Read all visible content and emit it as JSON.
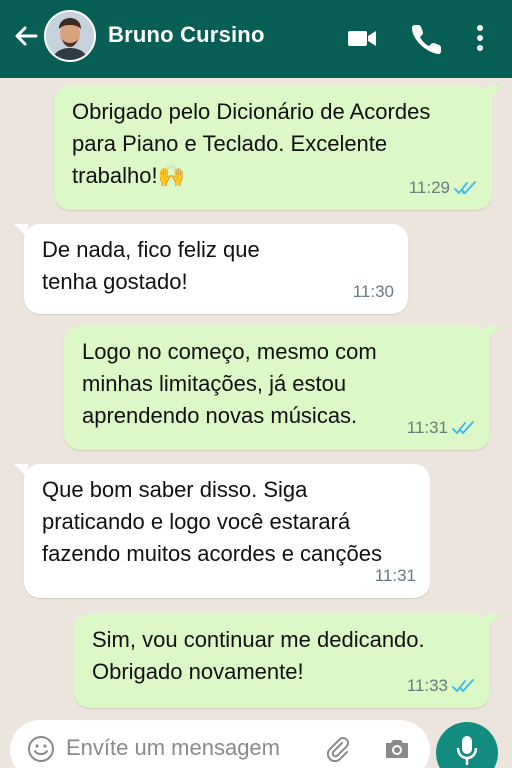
{
  "header": {
    "contact_name": "Bruno Cursino",
    "icons": [
      "back-arrow-icon",
      "avatar",
      "video-call-icon",
      "phone-call-icon",
      "more-options-icon"
    ]
  },
  "messages": [
    {
      "direction": "outgoing",
      "text": "Obrigado pelo Dicionário de Acordes\npara Piano e Teclado. Excelente\ntrabalho!🙌",
      "time": "11:29",
      "status": "read"
    },
    {
      "direction": "incoming",
      "text": "De nada, fico feliz que\ntenha gostado!",
      "time": "11:30"
    },
    {
      "direction": "outgoing",
      "text": "Logo no começo, mesmo com\nminhas limitações, já estou\naprendendo novas músicas.",
      "time": "11:31",
      "status": "read"
    },
    {
      "direction": "incoming",
      "text": "Que bom saber disso. Siga\npraticando e logo você estarará\nfazendo muitos acordes e canções",
      "time": "11:31"
    },
    {
      "direction": "outgoing",
      "text": "Sim, vou continuar me dedicando.\nObrigado novamente!",
      "time": "11:33",
      "status": "read"
    }
  ],
  "composer": {
    "placeholder": "Envíte um mensagem",
    "value": ""
  },
  "colors": {
    "header": "#075E54",
    "outgoing_bubble": "#DCF8C6",
    "incoming_bubble": "#FFFFFF",
    "background": "#ECE5DD",
    "read_ticks": "#34B7F1",
    "mic_button": "#128C7E"
  }
}
